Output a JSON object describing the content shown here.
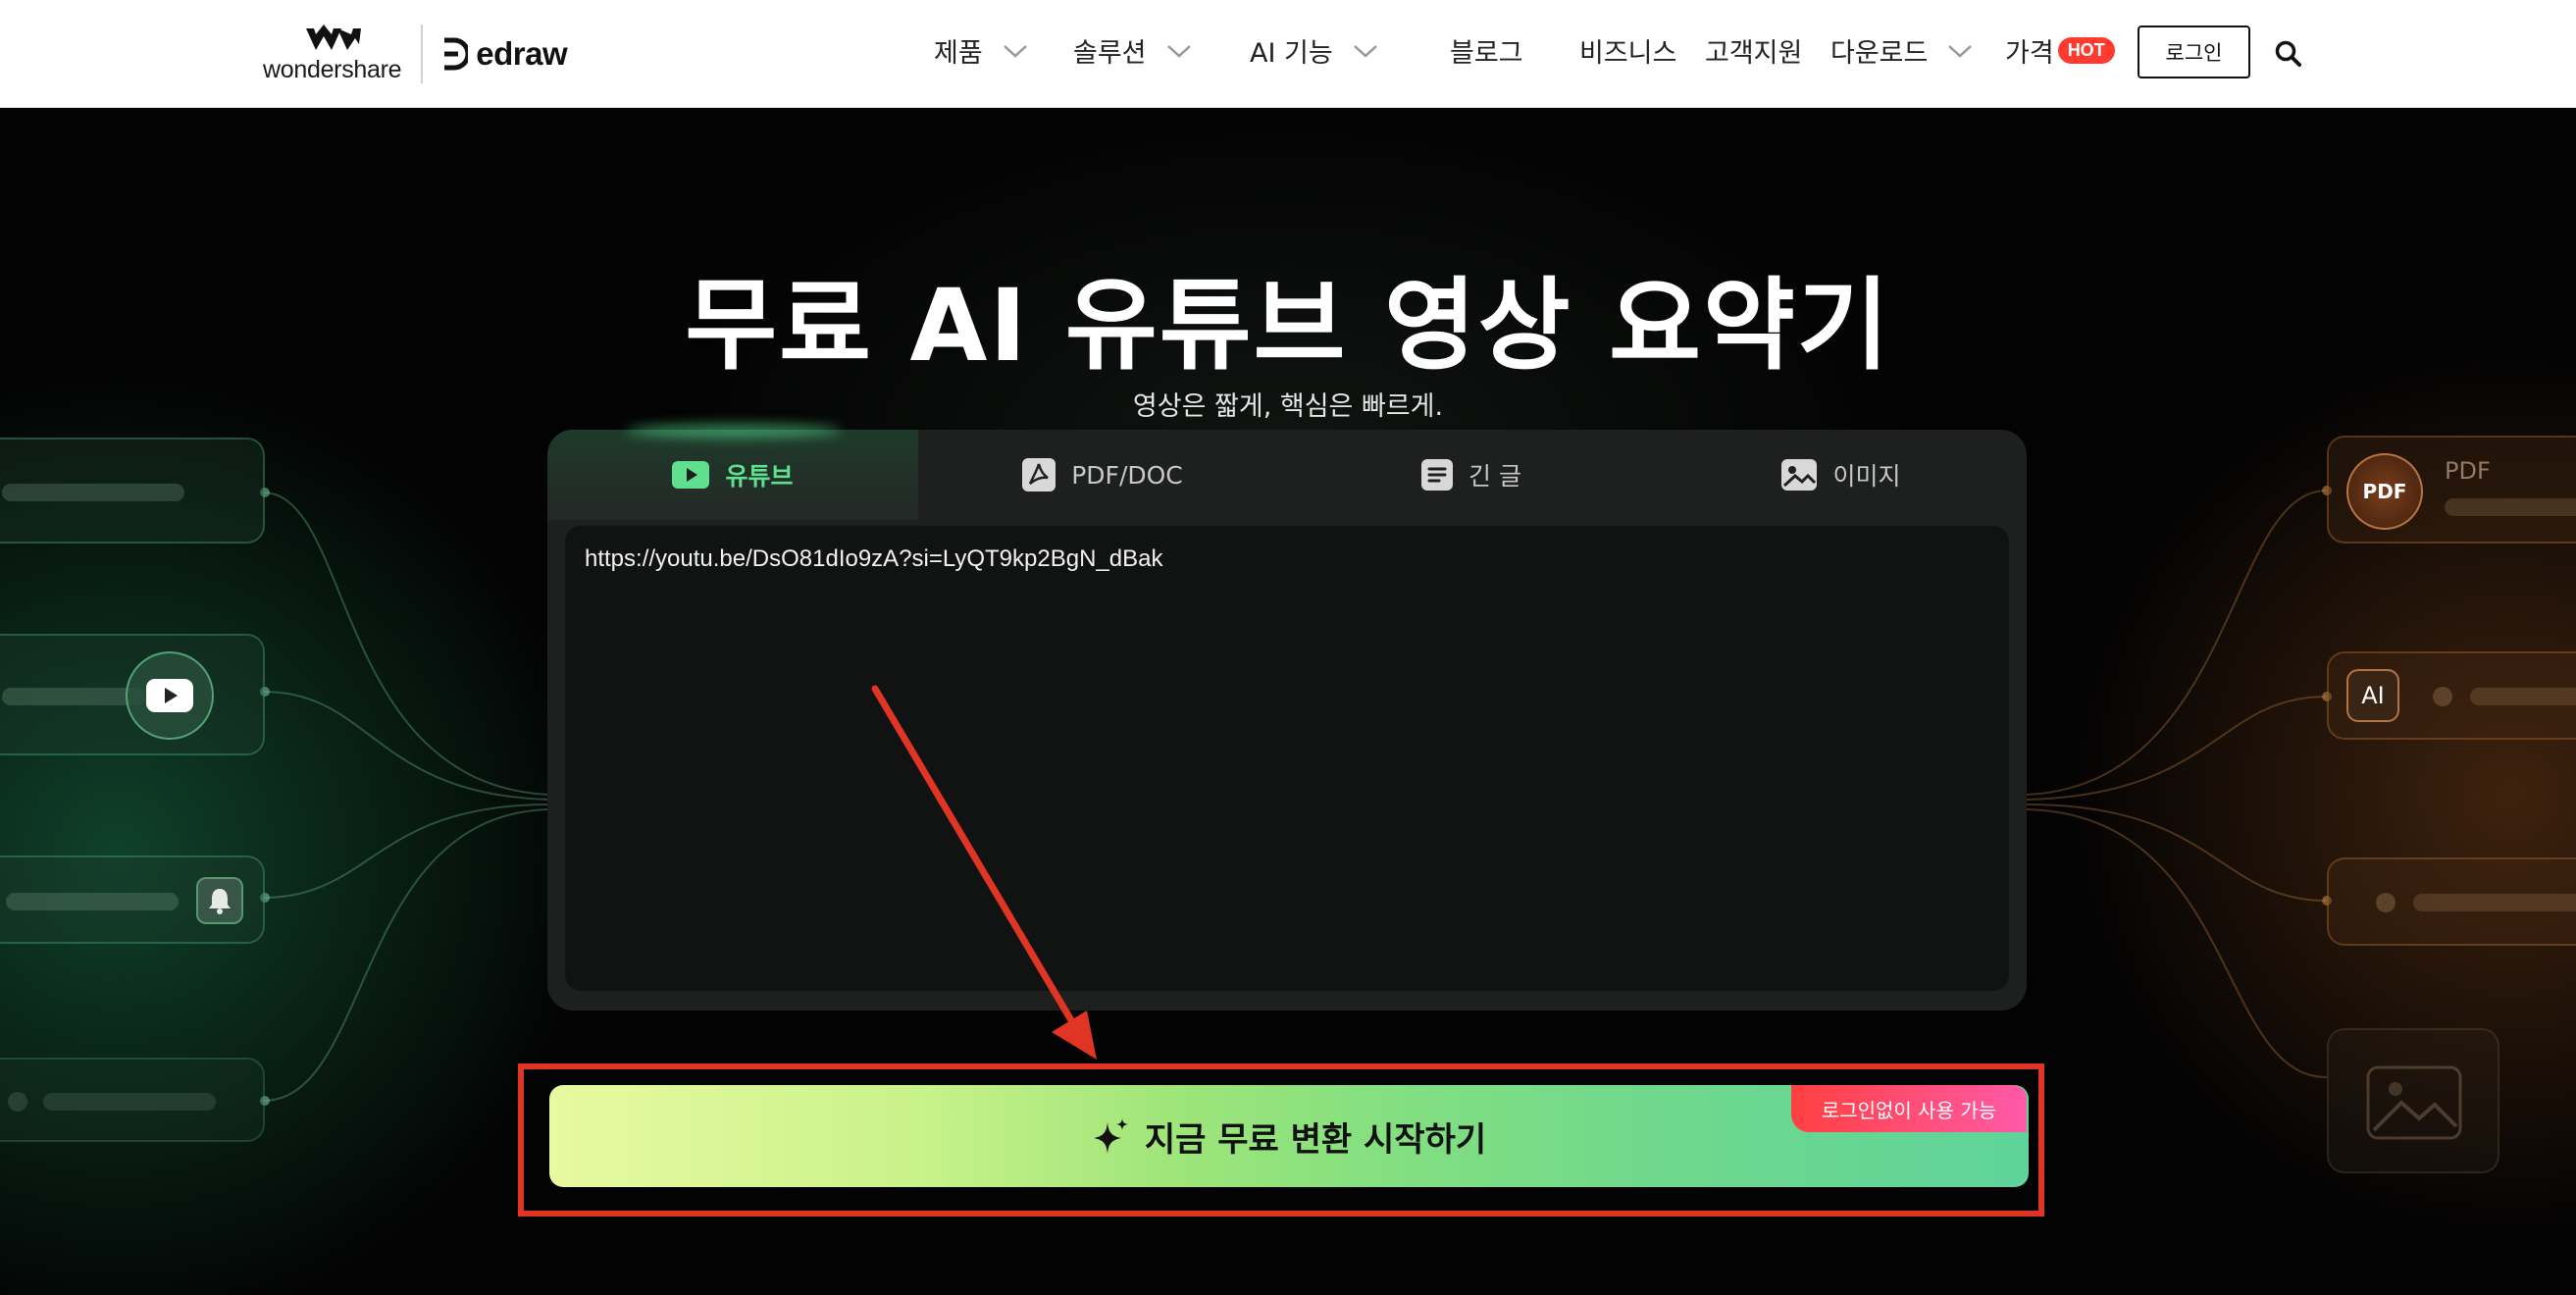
{
  "header": {
    "brand_primary": "wondershare",
    "brand_secondary": "edraw",
    "nav": [
      {
        "label": "제품",
        "has_dropdown": true
      },
      {
        "label": "솔루션",
        "has_dropdown": true
      },
      {
        "label": "AI 기능",
        "has_dropdown": true
      },
      {
        "label": "블로그",
        "has_dropdown": false
      },
      {
        "label": "비즈니스",
        "has_dropdown": false
      },
      {
        "label": "고객지원",
        "has_dropdown": false
      },
      {
        "label": "다운로드",
        "has_dropdown": true
      },
      {
        "label": "가격",
        "has_dropdown": false
      }
    ],
    "hot_badge": "HOT",
    "login_label": "로그인",
    "search_icon": "search-icon"
  },
  "hero": {
    "title": "무료 AI 유튜브 영상 요약기",
    "subtitle": "영상은 짧게, 핵심은 빠르게."
  },
  "tool": {
    "tabs": [
      {
        "label": "유튜브",
        "icon": "youtube-icon",
        "active": true
      },
      {
        "label": "PDF/DOC",
        "icon": "pdf-icon",
        "active": false
      },
      {
        "label": "긴 글",
        "icon": "document-icon",
        "active": false
      },
      {
        "label": "이미지",
        "icon": "image-icon",
        "active": false
      }
    ],
    "input_value": "https://youtu.be/DsO81dIo9zA?si=LyQT9kp2BgN_dBak"
  },
  "cta": {
    "label": "지금 무료 변환 시작하기",
    "badge": "로그인없이 사용 가능",
    "icon": "sparkle-icon"
  },
  "decor": {
    "right_pdf_badge": "PDF",
    "right_pdf_label": "PDF",
    "right_ai_badge": "AI"
  },
  "colors": {
    "accent_green": "#5fe08f",
    "annotation_red": "#e03424",
    "hot_red": "#ff3b30"
  }
}
